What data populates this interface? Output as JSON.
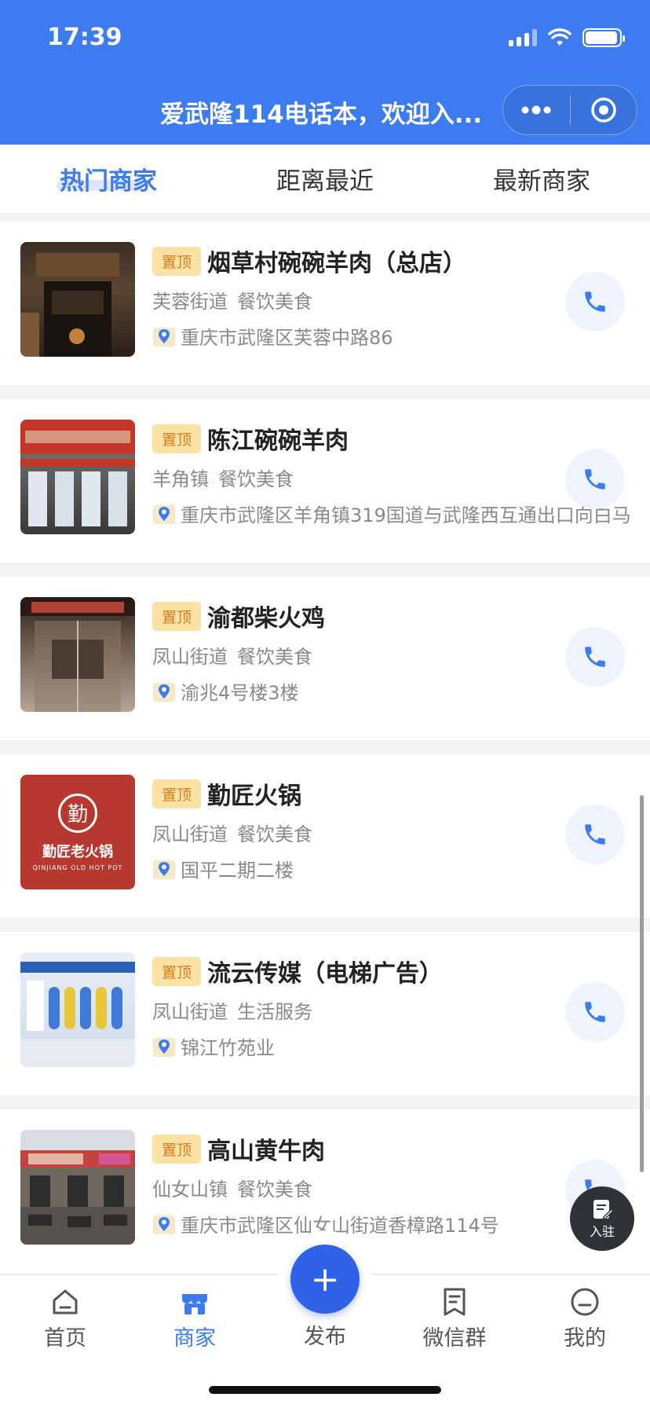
{
  "status_bar": {
    "time": "17:39"
  },
  "header": {
    "title": "爱武隆114电话本，欢迎入..."
  },
  "tabs": [
    {
      "label": "热门商家",
      "active": true
    },
    {
      "label": "距离最近",
      "active": false
    },
    {
      "label": "最新商家",
      "active": false
    }
  ],
  "merchants": [
    {
      "badge": "置顶",
      "name": "烟草村碗碗羊肉（总店）",
      "area": "芙蓉街道",
      "category": "餐饮美食",
      "address": "重庆市武隆区芙蓉中路86"
    },
    {
      "badge": "置顶",
      "name": "陈江碗碗羊肉",
      "area": "羊角镇",
      "category": "餐饮美食",
      "address": "重庆市武隆区羊角镇319国道与武隆西互通出口向白马"
    },
    {
      "badge": "置顶",
      "name": "渝都柴火鸡",
      "area": "凤山街道",
      "category": "餐饮美食",
      "address": "渝兆4号楼3楼"
    },
    {
      "badge": "置顶",
      "name": "勤匠火锅",
      "area": "凤山街道",
      "category": "餐饮美食",
      "address": "国平二期二楼"
    },
    {
      "badge": "置顶",
      "name": "流云传媒（电梯广告）",
      "area": "凤山街道",
      "category": "生活服务",
      "address": "锦江竹苑业"
    },
    {
      "badge": "置顶",
      "name": "高山黄牛肉",
      "area": "仙女山镇",
      "category": "餐饮美食",
      "address": "重庆市武隆区仙女山街道香樟路114号"
    }
  ],
  "thumb_text": {
    "qinjiang_char": "勤",
    "qinjiang_name": "勤匠老火锅",
    "qinjiang_sub": "QINJIANG OLD HOT POT"
  },
  "fab_join": {
    "label": "入驻"
  },
  "bottom_nav": {
    "home": "首页",
    "merchants": "商家",
    "publish": "发布",
    "wechat_group": "微信群",
    "mine": "我的",
    "publish_symbol": "+"
  },
  "colors": {
    "brand_blue": "#3d7cf0",
    "badge_bg": "#fae2a5",
    "badge_text": "#e07a1c"
  }
}
